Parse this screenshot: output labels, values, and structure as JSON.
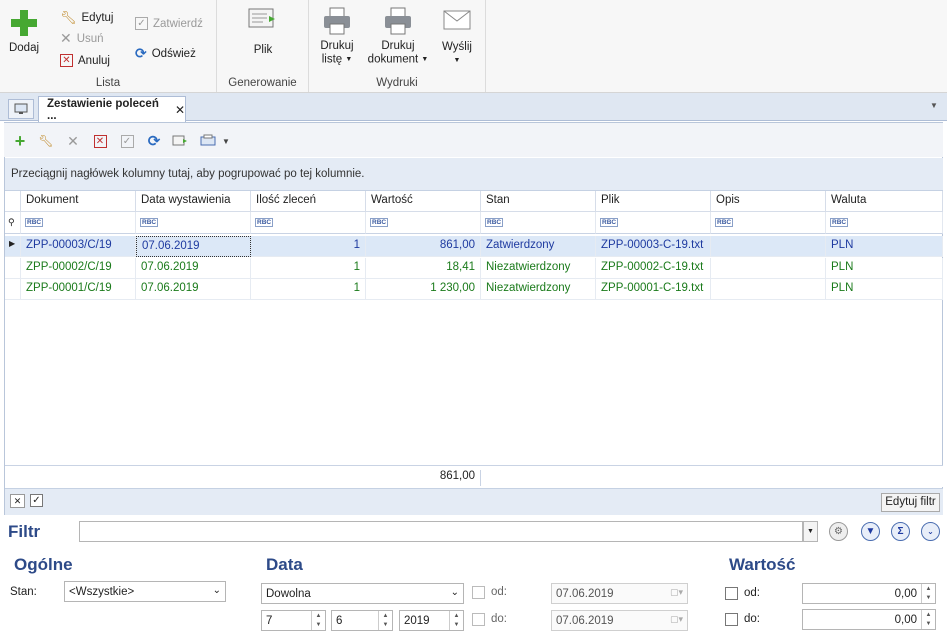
{
  "ribbon": {
    "lista": {
      "group_label": "Lista",
      "dodaj": "Dodaj",
      "edytuj": "Edytuj",
      "usun": "Usuń",
      "anuluj": "Anuluj",
      "zatwierdz": "Zatwierdź",
      "odswiez": "Odśwież"
    },
    "generowanie": {
      "group_label": "Generowanie",
      "plik": "Plik"
    },
    "wydruki": {
      "group_label": "Wydruki",
      "drukuj_liste_1": "Drukuj",
      "drukuj_liste_2": "listę",
      "drukuj_dok_1": "Drukuj",
      "drukuj_dok_2": "dokument",
      "wyslij": "Wyślij"
    }
  },
  "tab": {
    "label": "Zestawienie poleceń ...",
    "close": "✕"
  },
  "grid": {
    "group_hint": "Przeciągnij nagłówek kolumny tutaj, aby pogrupować po tej kolumnie.",
    "columns": [
      "Dokument",
      "Data wystawienia",
      "Ilość zleceń",
      "Wartość",
      "Stan",
      "Plik",
      "Opis",
      "Waluta"
    ],
    "filter_placeholder": "RBC",
    "rows": [
      {
        "dokument": "ZPP-00003/C/19",
        "data": "07.06.2019",
        "ilosc": "1",
        "wartosc": "861,00",
        "stan": "Zatwierdzony",
        "plik": "ZPP-00003-C-19.txt",
        "opis": "",
        "waluta": "PLN"
      },
      {
        "dokument": "ZPP-00002/C/19",
        "data": "07.06.2019",
        "ilosc": "1",
        "wartosc": "18,41",
        "stan": "Niezatwierdzony",
        "plik": "ZPP-00002-C-19.txt",
        "opis": "",
        "waluta": "PLN"
      },
      {
        "dokument": "ZPP-00001/C/19",
        "data": "07.06.2019",
        "ilosc": "1",
        "wartosc": "1 230,00",
        "stan": "Niezatwierdzony",
        "plik": "ZPP-00001-C-19.txt",
        "opis": "",
        "waluta": "PLN"
      }
    ],
    "summary_value": "861,00",
    "edit_filter": "Edytuj filtr"
  },
  "filter": {
    "label": "Filtr",
    "ogolne": {
      "title": "Ogólne",
      "stan_label": "Stan:",
      "stan_value": "<Wszystkie>"
    },
    "data": {
      "title": "Data",
      "range_value": "Dowolna",
      "day": "7",
      "month": "6",
      "year": "2019",
      "od_label": "od:",
      "od_value": "07.06.2019",
      "do_label": "do:",
      "do_value": "07.06.2019"
    },
    "wartosc": {
      "title": "Wartość",
      "od_label": "od:",
      "od_value": "0,00",
      "do_label": "do:",
      "do_value": "0,00"
    }
  },
  "colors": {
    "accent": "#2d4a88",
    "confirmed": "#1e3aa0",
    "unconfirmed": "#1a7a1a"
  }
}
